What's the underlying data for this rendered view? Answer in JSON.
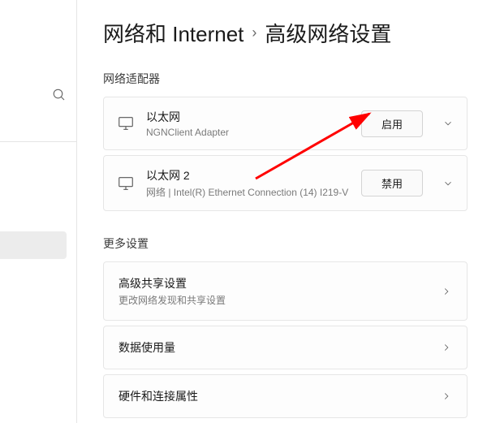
{
  "breadcrumb": {
    "parent": "网络和 Internet",
    "current": "高级网络设置"
  },
  "sections": {
    "adapters_title": "网络适配器",
    "more_title": "更多设置"
  },
  "adapters": [
    {
      "name": "以太网",
      "desc": "NGNClient Adapter",
      "action": "启用"
    },
    {
      "name": "以太网 2",
      "desc": "网络 | Intel(R) Ethernet Connection (14) I219-V",
      "action": "禁用"
    }
  ],
  "settings": [
    {
      "title": "高级共享设置",
      "sub": "更改网络发现和共享设置"
    },
    {
      "title": "数据使用量",
      "sub": ""
    },
    {
      "title": "硬件和连接属性",
      "sub": ""
    }
  ]
}
